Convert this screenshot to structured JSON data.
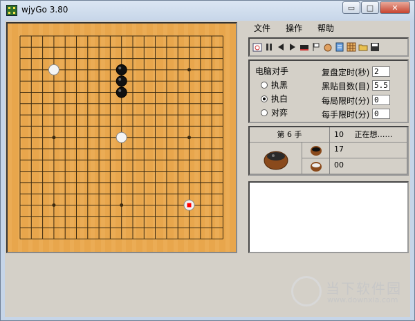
{
  "window": {
    "title": "wjyGo 3.80"
  },
  "window_buttons": {
    "minimize": "▭",
    "maximize": "□",
    "close": "✕"
  },
  "menu": [
    {
      "label": "文件"
    },
    {
      "label": "操作"
    },
    {
      "label": "帮助"
    }
  ],
  "toolbar_icons": [
    "new-game-icon",
    "pause-icon",
    "back-icon",
    "forward-icon",
    "black-bar-icon",
    "flag-icon",
    "hand-icon",
    "document-icon",
    "grid-icon",
    "open-folder-icon",
    "save-icon"
  ],
  "settings": {
    "computer_opponent_label": "电脑对手",
    "options": [
      {
        "label": "执黑",
        "selected": false
      },
      {
        "label": "执白",
        "selected": true
      },
      {
        "label": "对弈",
        "selected": false
      }
    ],
    "replay_timer_label": "复盘定时(秒)",
    "replay_timer_value": "2",
    "komi_label": "黑贴目数(目)",
    "komi_value": "5.5",
    "per_game_label": "每局限时(分)",
    "per_game_value": "0",
    "per_move_label": "每手限时(分)",
    "per_move_value": "0"
  },
  "status": {
    "move_label": "第 6 手",
    "counter": "10",
    "thinking": "正在想……",
    "black_time": "17",
    "white_time": "00"
  },
  "board": {
    "size": 19,
    "stars": [
      [
        3,
        3
      ],
      [
        9,
        3
      ],
      [
        15,
        3
      ],
      [
        3,
        9
      ],
      [
        9,
        9
      ],
      [
        15,
        9
      ],
      [
        3,
        15
      ],
      [
        9,
        15
      ],
      [
        15,
        15
      ]
    ],
    "black_stones": [
      [
        9,
        3
      ],
      [
        9,
        4
      ],
      [
        9,
        5
      ]
    ],
    "white_stones": [
      [
        3,
        3
      ],
      [
        9,
        9
      ],
      [
        15,
        15
      ]
    ],
    "last_move": [
      15,
      15
    ],
    "colors": {
      "wood": "#e8a64c",
      "line": "#3b2a10",
      "last_marker": "#ff0000"
    }
  },
  "watermark": {
    "title": "当下软件园",
    "url": "www.downxia.com"
  }
}
